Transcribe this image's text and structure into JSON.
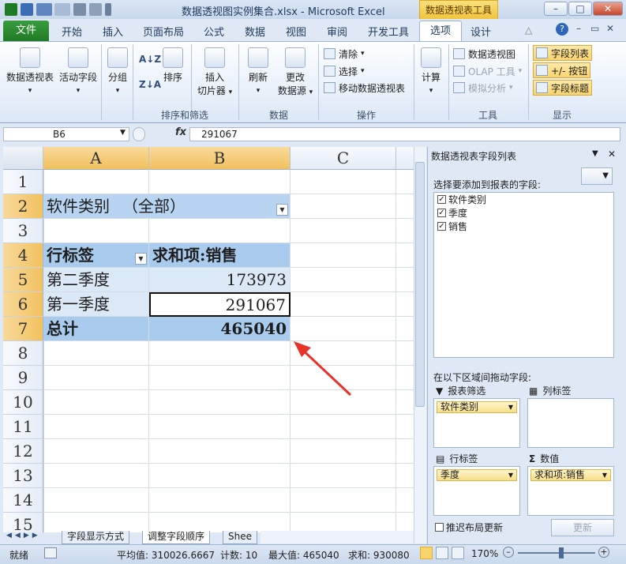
{
  "window": {
    "title": "数据透视图实例集合.xlsx - Microsoft Excel",
    "context_tab": "数据透视表工具",
    "minimize": "–",
    "maximize": "□",
    "close": "✕"
  },
  "ribbon_tabs": [
    "文件",
    "开始",
    "插入",
    "页面布局",
    "公式",
    "数据",
    "视图",
    "审阅",
    "开发工具",
    "选项",
    "设计"
  ],
  "ribbon": {
    "pivot_table": "数据透视表",
    "active_field": "活动字段",
    "group": "分组",
    "sort": "排序",
    "insert_slicer_1": "插入",
    "insert_slicer_2": "切片器",
    "refresh": "刷新",
    "change_source_1": "更改",
    "change_source_2": "数据源",
    "clear": "清除",
    "select": "选择",
    "move_pivot": "移动数据透视表",
    "calculate": "计算",
    "pivot_chart": "数据透视图",
    "olap_tools": "OLAP 工具",
    "what_if": "模拟分析",
    "field_list": "字段列表",
    "plus_minus": "+/- 按钮",
    "field_headers": "字段标题",
    "groups": {
      "sort_filter": "排序和筛选",
      "data": "数据",
      "actions": "操作",
      "tools": "工具",
      "show": "显示"
    }
  },
  "formula_bar": {
    "name_box": "B6",
    "fx": "fx",
    "value": "291067"
  },
  "sheet": {
    "columns": [
      "A",
      "B",
      "C"
    ],
    "rows": [
      "1",
      "2",
      "3",
      "4",
      "5",
      "6",
      "7",
      "8",
      "9",
      "10",
      "11",
      "12",
      "13",
      "14",
      "15"
    ],
    "filter_label": "软件类别",
    "filter_value": "（全部）",
    "header_row_label": "行标签",
    "header_sum": "求和项:销售",
    "data_rows": [
      {
        "label": "第二季度",
        "value": "173973"
      },
      {
        "label": "第一季度",
        "value": "291067"
      }
    ],
    "total_label": "总计",
    "total_value": "465040"
  },
  "sheet_tabs": [
    "字段显示方式",
    "调整字段顺序",
    "Shee"
  ],
  "field_pane": {
    "title": "数据透视表字段列表",
    "choose_label": "选择要添加到报表的字段:",
    "fields": [
      "软件类别",
      "季度",
      "销售"
    ],
    "drag_label": "在以下区域间拖动字段:",
    "report_filter": "报表筛选",
    "column_labels": "列标签",
    "row_labels": "行标签",
    "values": "数值",
    "filter_item": "软件类别",
    "row_item": "季度",
    "value_item": "求和项:销售",
    "defer_update": "推迟布局更新",
    "update_btn": "更新"
  },
  "status": {
    "ready": "就绪",
    "average": "平均值: 310026.6667",
    "count": "计数: 10",
    "max": "最大值: 465040",
    "sum": "求和: 930080",
    "zoom": "170%"
  }
}
